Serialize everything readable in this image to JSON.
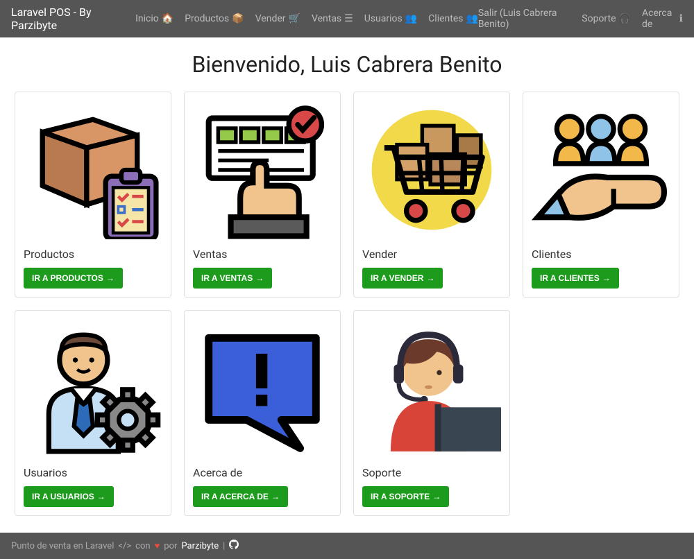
{
  "navbar": {
    "brand": "Laravel POS - By Parzibyte",
    "links": [
      {
        "label": "Inicio",
        "icon": "home-icon"
      },
      {
        "label": "Productos",
        "icon": "box-icon"
      },
      {
        "label": "Vender",
        "icon": "cart-icon"
      },
      {
        "label": "Ventas",
        "icon": "list-icon"
      },
      {
        "label": "Usuarios",
        "icon": "users-icon"
      },
      {
        "label": "Clientes",
        "icon": "users-icon"
      }
    ],
    "right": [
      {
        "label": "Salir (Luis Cabrera Benito)"
      },
      {
        "label": "Soporte",
        "icon": "headset-icon"
      },
      {
        "label": "Acerca de",
        "icon": "info-icon"
      }
    ]
  },
  "welcome": "Bienvenido, Luis Cabrera Benito",
  "cards": [
    {
      "title": "Productos",
      "button": "IR A PRODUCTOS",
      "icon": "productos"
    },
    {
      "title": "Ventas",
      "button": "IR A VENTAS",
      "icon": "ventas"
    },
    {
      "title": "Vender",
      "button": "IR A VENDER",
      "icon": "vender"
    },
    {
      "title": "Clientes",
      "button": "IR A CLIENTES",
      "icon": "clientes"
    },
    {
      "title": "Usuarios",
      "button": "IR A USUARIOS",
      "icon": "usuarios"
    },
    {
      "title": "Acerca de",
      "button": "IR A ACERCA DE",
      "icon": "acerca"
    },
    {
      "title": "Soporte",
      "button": "IR A SOPORTE",
      "icon": "soporte"
    }
  ],
  "footer": {
    "text1": "Punto de venta en Laravel",
    "text2": "con",
    "text3": "por",
    "author": "Parzibyte"
  }
}
